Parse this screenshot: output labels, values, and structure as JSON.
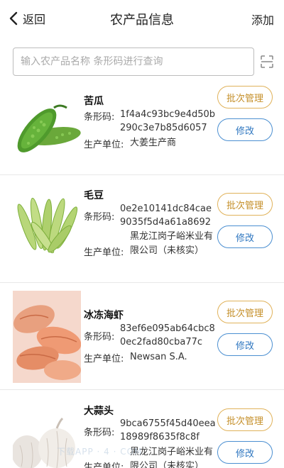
{
  "navbar": {
    "back_label": "返回",
    "title": "农产品信息",
    "add_label": "添加"
  },
  "search": {
    "placeholder": "输入农产品名称 条形码进行查询"
  },
  "labels": {
    "barcode": "条形码:",
    "producer": "生产单位:",
    "batch_button": "批次管理",
    "edit_button": "修改"
  },
  "products": [
    {
      "name": "苦瓜",
      "barcode": "1f4a4c93bc9e4d50b290c3e7b85d6057",
      "producer": "大姜生产商"
    },
    {
      "name": "毛豆",
      "barcode": "0e2e10141dc84cae9035f5d4a61a8692",
      "producer": "黑龙江岗子峪米业有限公司（未核实）"
    },
    {
      "name": "冰冻海虾",
      "barcode": "83ef6e095ab64cbc80ec2fad80cba77c",
      "producer": "Newsan S.A."
    },
    {
      "name": "大蒜头",
      "barcode": "9bca6755f45d40eea18989f8635f8c8f",
      "producer": "黑龙江岗子峪米业有限公司（未核实）"
    }
  ],
  "watermark": "下载APP · 4 · COM"
}
